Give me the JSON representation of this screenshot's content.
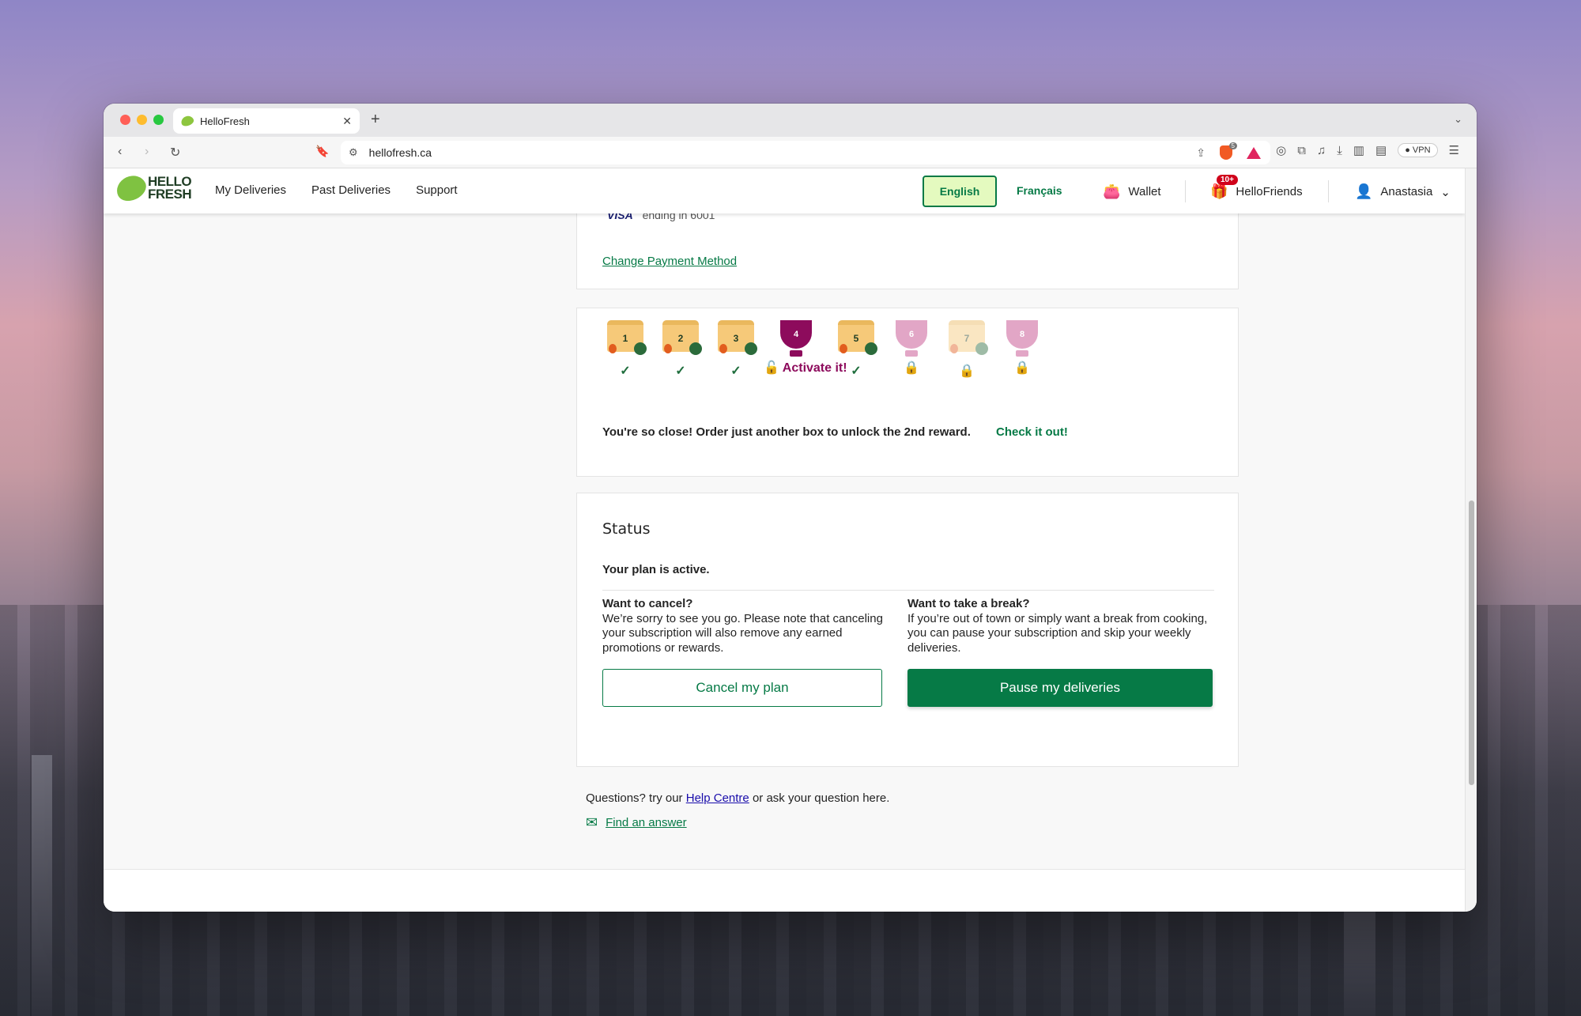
{
  "browser": {
    "tab_title": "HelloFresh",
    "url": "hellofresh.ca",
    "shields_count": "5",
    "vpn_label": "VPN"
  },
  "nav": {
    "logo_line1": "HELLO",
    "logo_line2": "FRESH",
    "links": [
      "My Deliveries",
      "Past Deliveries",
      "Support"
    ],
    "lang_english": "English",
    "lang_french": "Français",
    "wallet": "Wallet",
    "friends": "HelloFriends",
    "friends_badge": "10+",
    "user": "Anastasia"
  },
  "payment": {
    "card_text": "ending in 6001",
    "card_brand": "VISA",
    "change_link": "Change Payment Method"
  },
  "rewards": {
    "items": [
      {
        "number": "1",
        "kind": "box",
        "status": "check"
      },
      {
        "number": "2",
        "kind": "box",
        "status": "check"
      },
      {
        "number": "3",
        "kind": "box",
        "status": "check"
      },
      {
        "number": "4",
        "kind": "trophy",
        "status": "activate"
      },
      {
        "number": "5",
        "kind": "box",
        "status": "check"
      },
      {
        "number": "6",
        "kind": "trophy-locked",
        "status": "lock"
      },
      {
        "number": "7",
        "kind": "box-locked",
        "status": "lock"
      },
      {
        "number": "8",
        "kind": "trophy-locked",
        "status": "lock"
      }
    ],
    "activate_label": "Activate it!",
    "message": "You're so close! Order just another box to unlock the 2nd reward.",
    "cta": "Check it out!"
  },
  "status": {
    "title": "Status",
    "plan_text": "Your plan is active.",
    "cancel_heading": "Want to cancel?",
    "cancel_body": "We’re sorry to see you go. Please note that canceling your subscription will also remove any earned promotions or rewards.",
    "break_heading": "Want to take a break?",
    "break_body": "If you’re out of town or simply want a break from cooking, you can pause your subscription and skip your weekly deliveries.",
    "cancel_button": "Cancel my plan",
    "pause_button": "Pause my deliveries"
  },
  "help": {
    "text_before": "Questions? try our ",
    "help_link": "Help Centre",
    "text_after": " or ask your question here.",
    "find_answer": "Find an answer"
  },
  "colors": {
    "brand_green": "#067a46",
    "light_green": "#e4fabf",
    "reward_purple": "#8d0b5c",
    "badge_red": "#d0021b"
  }
}
